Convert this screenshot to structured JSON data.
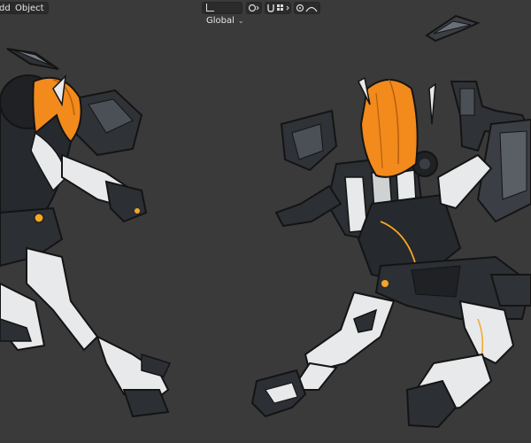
{
  "header": {
    "add_menu": "dd",
    "object_menu": "Object",
    "orientation": {
      "icon": "transform-orientation-icon",
      "label": "Global",
      "chevron": "⌄"
    },
    "pivot": {
      "icon": "pivot-point-icon"
    },
    "snap": {
      "icon": "snap-magnet-icon",
      "increment_icon": "snap-increment-icon"
    },
    "proportional": {
      "icon": "proportional-editing-icon",
      "falloff_icon": "falloff-curve-icon"
    }
  },
  "viewport": {
    "background": "#3a3a3a",
    "subject": "two armored mecha-girl figures with orange hair"
  },
  "colors": {
    "hair": "#f28a1c",
    "armor_dark": "#2c2f33",
    "armor_mid": "#5a5f66",
    "armor_white": "#e8e9ea",
    "accent_orange": "#f5a623",
    "outline": "#141414"
  }
}
